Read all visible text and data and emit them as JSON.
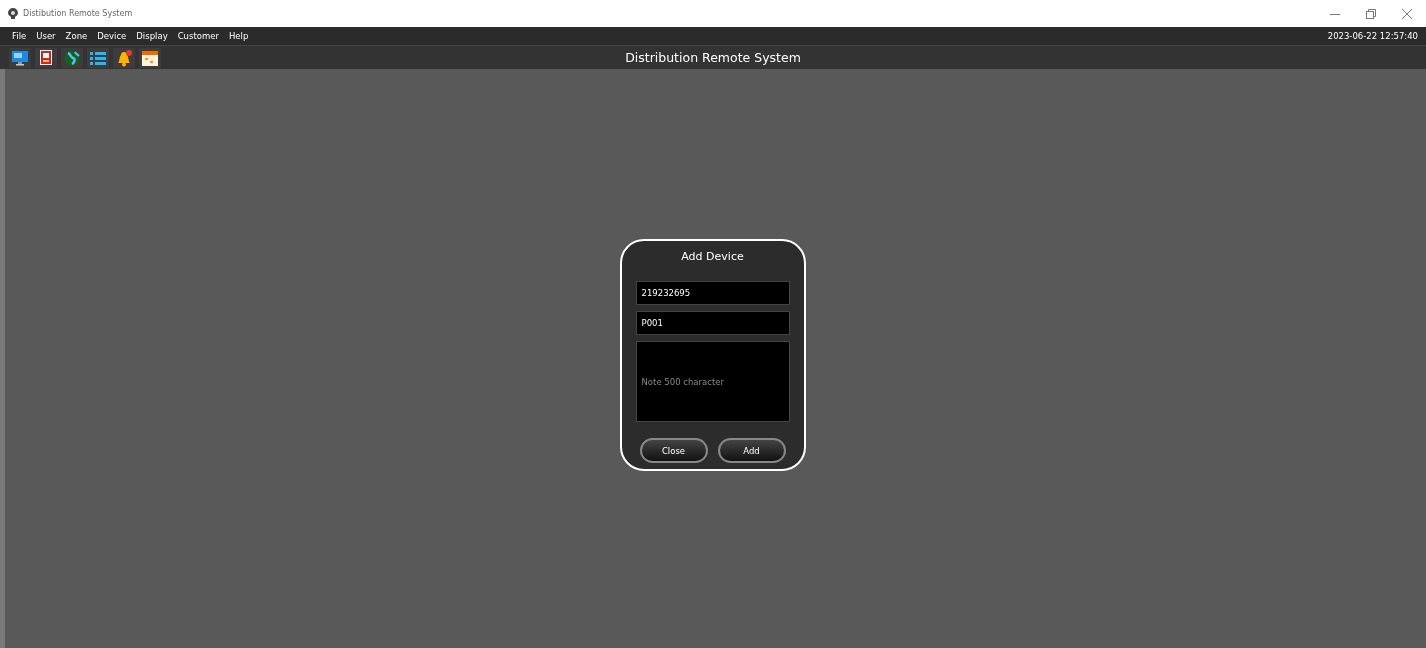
{
  "window": {
    "title": "Distibution Remote System"
  },
  "menu": [
    "File",
    "User",
    "Zone",
    "Device",
    "Display",
    "Customer",
    "Help"
  ],
  "clock": "2023-06-22 12:57:40",
  "toolbar": {
    "title": "Distribution Remote System",
    "tools": [
      {
        "kind": "monitor"
      },
      {
        "kind": "register"
      },
      {
        "kind": "globe"
      },
      {
        "kind": "list"
      },
      {
        "kind": "bell"
      },
      {
        "kind": "calendar"
      }
    ]
  },
  "dialog": {
    "title": "Add Device",
    "fields": [
      {
        "value": "219232695"
      },
      {
        "value": "P001"
      }
    ],
    "note": {
      "placeholder": "Note 500 character"
    },
    "buttons": [
      "Close",
      "Add"
    ]
  }
}
